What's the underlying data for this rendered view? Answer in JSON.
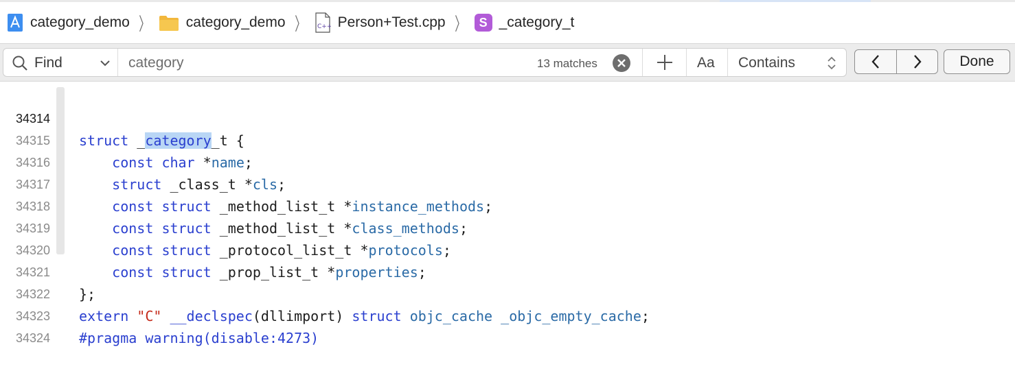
{
  "breadcrumb": {
    "project": "category_demo",
    "folder": "category_demo",
    "file": "Person+Test.cpp",
    "file_icon_label": "C++",
    "symbol_badge": "S",
    "symbol": "_category_t"
  },
  "find_bar": {
    "mode": "Find",
    "query": "category",
    "match_count": "13 matches",
    "case_toggle": "Aa",
    "match_type": "Contains",
    "done_label": "Done"
  },
  "editor": {
    "current_line": "34314",
    "lines": [
      {
        "num": "34314"
      },
      {
        "num": "34315"
      },
      {
        "num": "34316"
      },
      {
        "num": "34317"
      },
      {
        "num": "34318"
      },
      {
        "num": "34319"
      },
      {
        "num": "34320"
      },
      {
        "num": "34321"
      },
      {
        "num": "34322"
      },
      {
        "num": "34323"
      },
      {
        "num": "34324"
      }
    ],
    "code": {
      "l1": [
        "struct",
        " _",
        "category",
        "_t {"
      ],
      "l2": [
        "const",
        "char",
        "*",
        "name",
        ";"
      ],
      "l3": [
        "struct",
        "_class_t",
        "*",
        "cls",
        ";"
      ],
      "l4": [
        "const",
        "struct",
        "_method_list_t",
        "*",
        "instance_methods",
        ";"
      ],
      "l5": [
        "const",
        "struct",
        "_method_list_t",
        "*",
        "class_methods",
        ";"
      ],
      "l6": [
        "const",
        "struct",
        "_protocol_list_t",
        "*",
        "protocols",
        ";"
      ],
      "l7": [
        "const",
        "struct",
        "_prop_list_t",
        "*",
        "properties",
        ";"
      ],
      "l8": [
        "};"
      ],
      "l9": [
        "extern",
        "\"C\"",
        "__declspec",
        "(dllimport)",
        "struct",
        "objc_cache",
        "_objc_empty_cache",
        ";"
      ],
      "l10": [
        "#pragma",
        "warning(disable:4273)"
      ]
    }
  },
  "colors": {
    "keyword": "#2a3fcf",
    "identifier": "#2a6aa6",
    "string": "#c52a1a",
    "match_highlight": "#b9d6f5",
    "symbol_badge": "#b25bd8"
  }
}
